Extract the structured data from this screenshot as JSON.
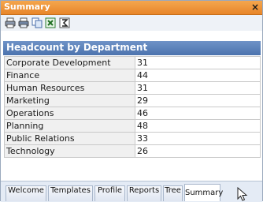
{
  "window": {
    "title": "Summary",
    "close_glyph": "×"
  },
  "toolbar": {
    "icons": [
      "print-icon",
      "print-preview-icon",
      "copy-icon",
      "excel-export-icon",
      "sum-icon"
    ]
  },
  "panel": {
    "header": "Headcount by Department",
    "rows": [
      {
        "dept": "Corporate Development",
        "count": "31"
      },
      {
        "dept": "Finance",
        "count": "44"
      },
      {
        "dept": "Human Resources",
        "count": "31"
      },
      {
        "dept": "Marketing",
        "count": "29"
      },
      {
        "dept": "Operations",
        "count": "46"
      },
      {
        "dept": "Planning",
        "count": "48"
      },
      {
        "dept": "Public Relations",
        "count": "33"
      },
      {
        "dept": "Technology",
        "count": "26"
      }
    ]
  },
  "tabs": [
    {
      "label": "Welcome"
    },
    {
      "label": "Templates"
    },
    {
      "label": "Profile"
    },
    {
      "label": "Reports"
    },
    {
      "label": "Tree"
    },
    {
      "label": "Summary"
    }
  ],
  "active_tab": "Summary",
  "colors": {
    "titlebar": "#e8862a",
    "header": "#4c73ae",
    "tabbar": "#e4ebf5"
  }
}
